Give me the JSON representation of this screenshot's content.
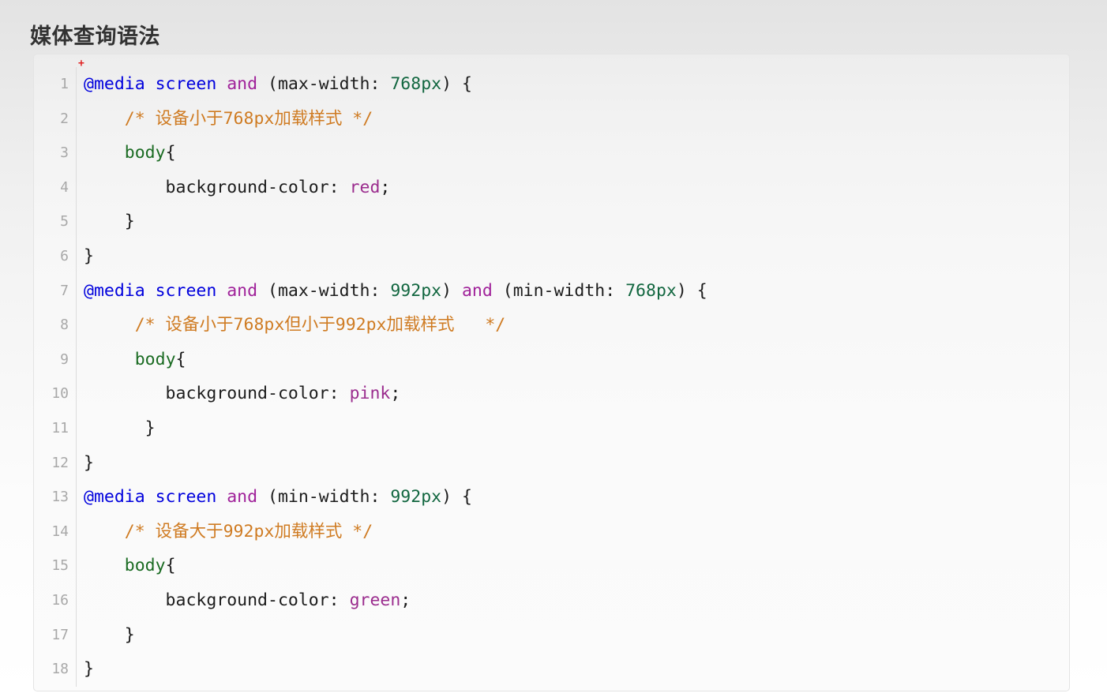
{
  "page": {
    "title": "媒体查询语法",
    "background_gradient_from": "#e3e3e3",
    "background_gradient_to": "#ffffff"
  },
  "code_block": {
    "language": "css",
    "marker": "+",
    "marker_color": "#e02020",
    "panel_background": "#f7f7f7",
    "panel_border_color": "#e4e4e4",
    "gutter_divider_color": "#dcdcdc",
    "line_number_color": "#a8a8a8",
    "total_lines": 18,
    "theme_colors": {
      "atrule": "#0000dd",
      "keyword": "#0000dd",
      "and_operator": "#a0229a",
      "number": "#11663f",
      "comment": "#cf7b22",
      "selector": "#1a6b22",
      "property": "#1c1c1c",
      "value": "#9b2d8e",
      "punctuation": "#1c1c1c"
    },
    "lines": [
      {
        "n": "1",
        "text": "@media screen and (max-width: 768px) {"
      },
      {
        "n": "2",
        "text": "    /* 设备小于768px加载样式 */"
      },
      {
        "n": "3",
        "text": "    body{"
      },
      {
        "n": "4",
        "text": "        background-color: red;"
      },
      {
        "n": "5",
        "text": "    }"
      },
      {
        "n": "6",
        "text": "}"
      },
      {
        "n": "7",
        "text": "@media screen and (max-width: 992px) and (min-width: 768px) {"
      },
      {
        "n": "8",
        "text": "     /* 设备小于768px但小于992px加载样式   */"
      },
      {
        "n": "9",
        "text": "     body{"
      },
      {
        "n": "10",
        "text": "        background-color: pink;"
      },
      {
        "n": "11",
        "text": "      }"
      },
      {
        "n": "12",
        "text": "}"
      },
      {
        "n": "13",
        "text": "@media screen and (min-width: 992px) {"
      },
      {
        "n": "14",
        "text": "    /* 设备大于992px加载样式 */"
      },
      {
        "n": "15",
        "text": "    body{"
      },
      {
        "n": "16",
        "text": "        background-color: green;"
      },
      {
        "n": "17",
        "text": "    }"
      },
      {
        "n": "18",
        "text": "}"
      }
    ],
    "tokens": [
      [
        {
          "t": "@media screen",
          "c": "t-atrule"
        },
        {
          "t": " ",
          "c": "t-punct"
        },
        {
          "t": "and",
          "c": "t-and"
        },
        {
          "t": " (max-width: ",
          "c": "t-punct"
        },
        {
          "t": "768px",
          "c": "t-num"
        },
        {
          "t": ") {",
          "c": "t-punct"
        }
      ],
      [
        {
          "t": "    /* 设备小于768px加载样式 */",
          "c": "t-comment"
        }
      ],
      [
        {
          "t": "    ",
          "c": "t-punct"
        },
        {
          "t": "body",
          "c": "t-selector"
        },
        {
          "t": "{",
          "c": "t-punct"
        }
      ],
      [
        {
          "t": "        background-color",
          "c": "t-prop"
        },
        {
          "t": ": ",
          "c": "t-punct"
        },
        {
          "t": "red",
          "c": "t-value"
        },
        {
          "t": ";",
          "c": "t-punct"
        }
      ],
      [
        {
          "t": "    }",
          "c": "t-punct"
        }
      ],
      [
        {
          "t": "}",
          "c": "t-punct"
        }
      ],
      [
        {
          "t": "@media screen",
          "c": "t-atrule"
        },
        {
          "t": " ",
          "c": "t-punct"
        },
        {
          "t": "and",
          "c": "t-and"
        },
        {
          "t": " (max-width: ",
          "c": "t-punct"
        },
        {
          "t": "992px",
          "c": "t-num"
        },
        {
          "t": ") ",
          "c": "t-punct"
        },
        {
          "t": "and",
          "c": "t-and"
        },
        {
          "t": " (min-width: ",
          "c": "t-punct"
        },
        {
          "t": "768px",
          "c": "t-num"
        },
        {
          "t": ") {",
          "c": "t-punct"
        }
      ],
      [
        {
          "t": "     /* 设备小于768px但小于992px加载样式   */",
          "c": "t-comment"
        }
      ],
      [
        {
          "t": "     ",
          "c": "t-punct"
        },
        {
          "t": "body",
          "c": "t-selector"
        },
        {
          "t": "{",
          "c": "t-punct"
        }
      ],
      [
        {
          "t": "        background-color",
          "c": "t-prop"
        },
        {
          "t": ": ",
          "c": "t-punct"
        },
        {
          "t": "pink",
          "c": "t-value"
        },
        {
          "t": ";",
          "c": "t-punct"
        }
      ],
      [
        {
          "t": "      }",
          "c": "t-punct"
        }
      ],
      [
        {
          "t": "}",
          "c": "t-punct"
        }
      ],
      [
        {
          "t": "@media screen",
          "c": "t-atrule"
        },
        {
          "t": " ",
          "c": "t-punct"
        },
        {
          "t": "and",
          "c": "t-and"
        },
        {
          "t": " (min-width: ",
          "c": "t-punct"
        },
        {
          "t": "992px",
          "c": "t-num"
        },
        {
          "t": ") {",
          "c": "t-punct"
        }
      ],
      [
        {
          "t": "    /* 设备大于992px加载样式 */",
          "c": "t-comment"
        }
      ],
      [
        {
          "t": "    ",
          "c": "t-punct"
        },
        {
          "t": "body",
          "c": "t-selector"
        },
        {
          "t": "{",
          "c": "t-punct"
        }
      ],
      [
        {
          "t": "        background-color",
          "c": "t-prop"
        },
        {
          "t": ": ",
          "c": "t-punct"
        },
        {
          "t": "green",
          "c": "t-value"
        },
        {
          "t": ";",
          "c": "t-punct"
        }
      ],
      [
        {
          "t": "    }",
          "c": "t-punct"
        }
      ],
      [
        {
          "t": "}",
          "c": "t-punct"
        }
      ]
    ]
  }
}
